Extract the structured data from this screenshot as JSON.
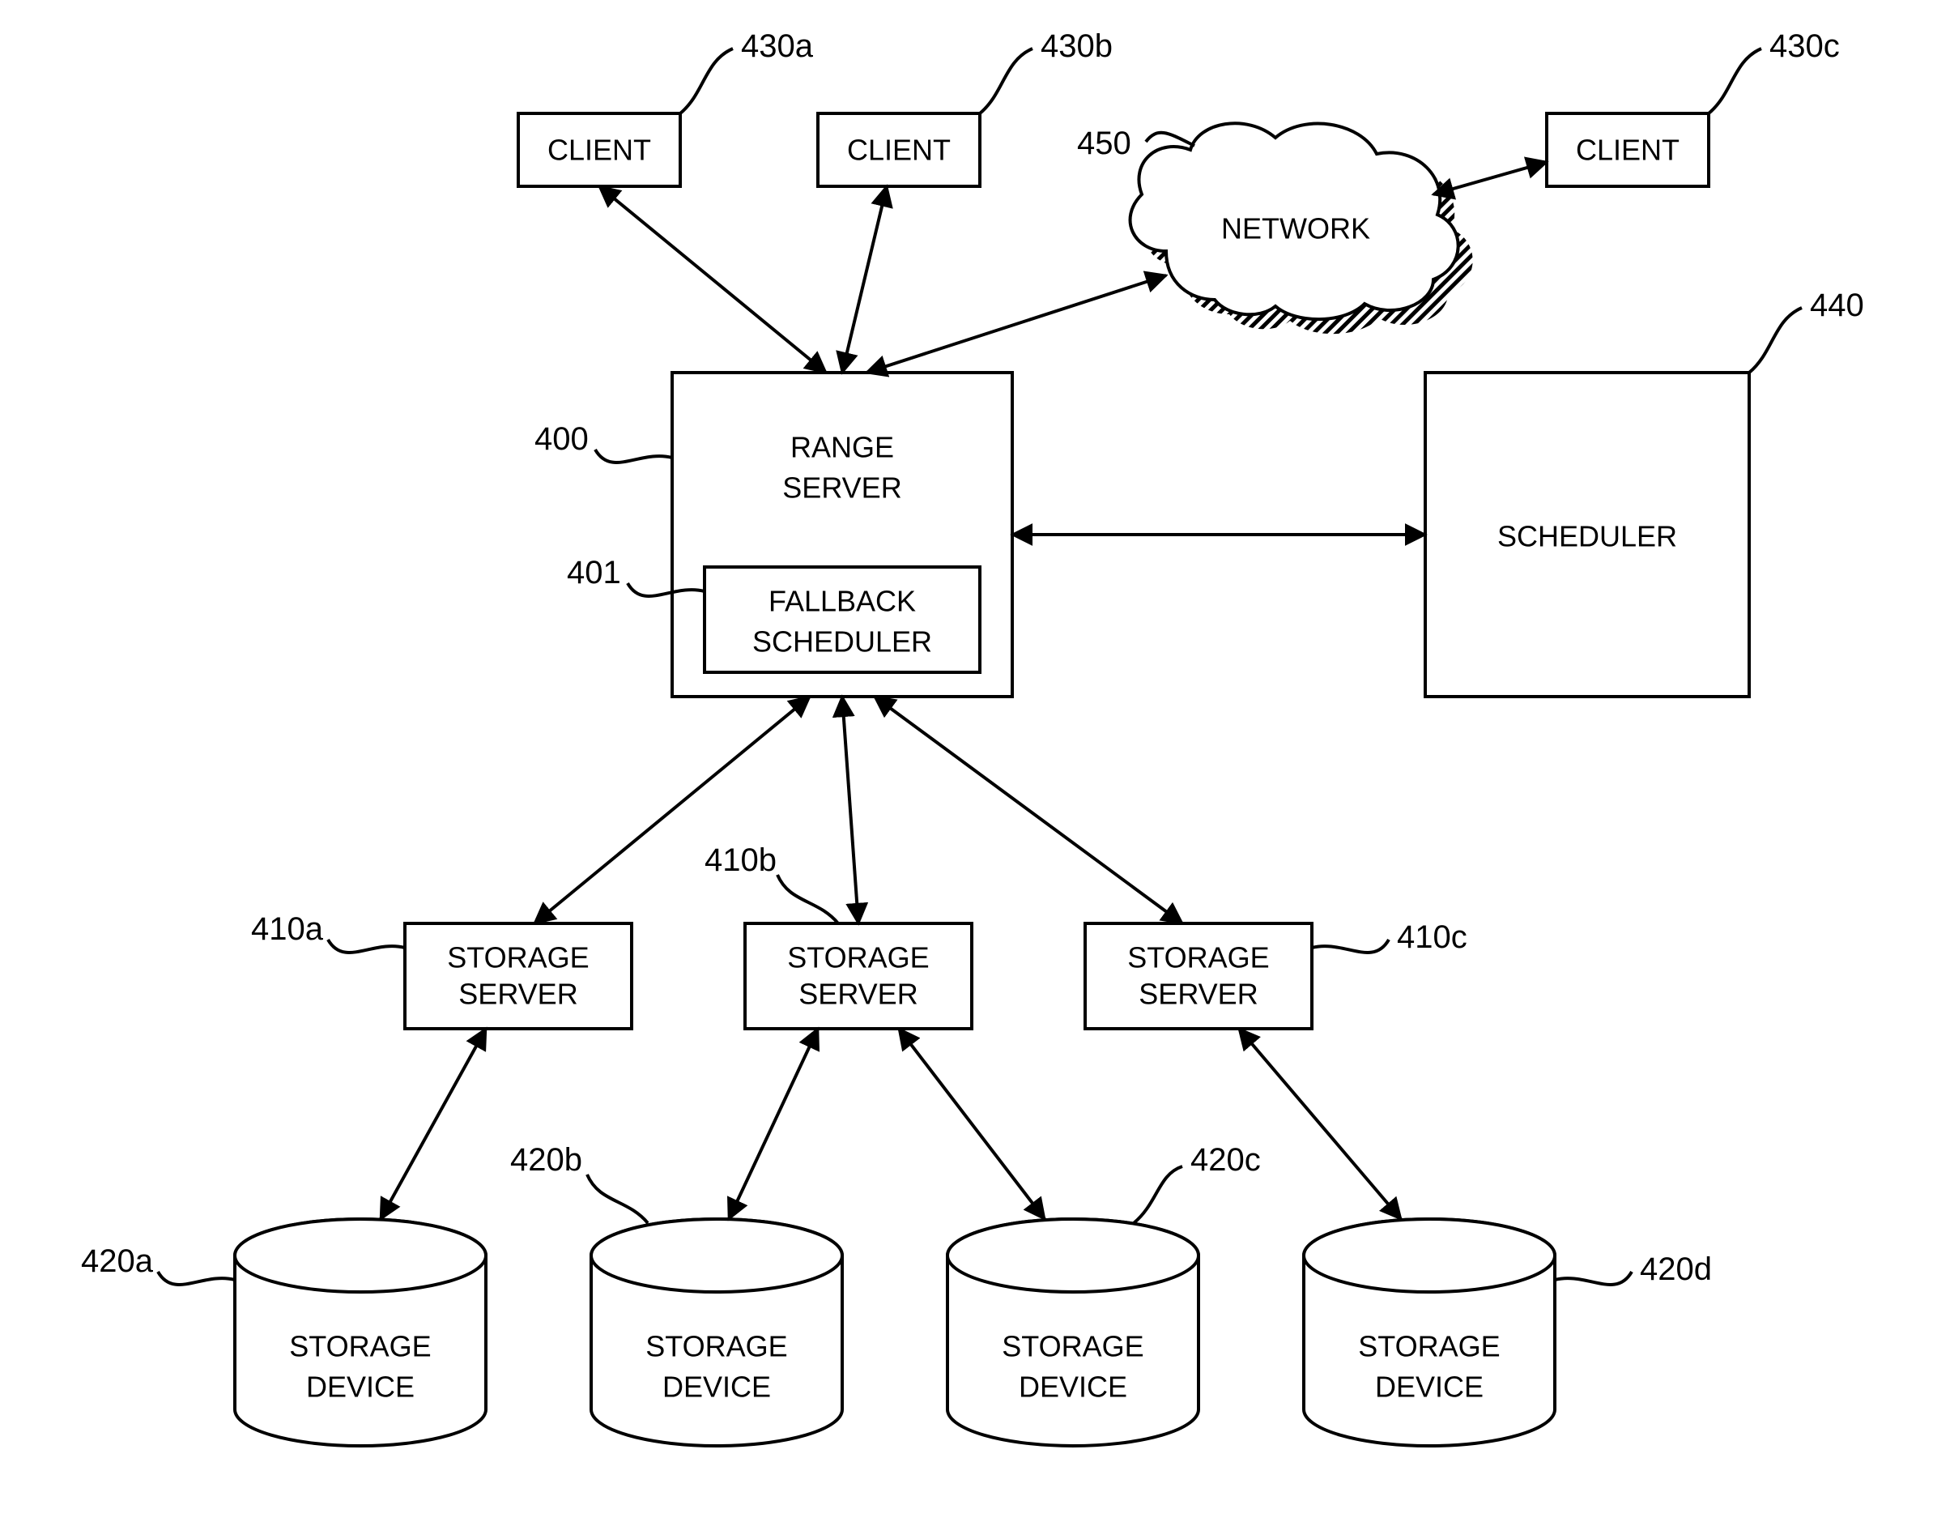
{
  "clients": {
    "a": {
      "label": "CLIENT",
      "ref": "430a"
    },
    "b": {
      "label": "CLIENT",
      "ref": "430b"
    },
    "c": {
      "label": "CLIENT",
      "ref": "430c"
    }
  },
  "network": {
    "label": "NETWORK",
    "ref": "450"
  },
  "range_server": {
    "label_line1": "RANGE",
    "label_line2": "SERVER",
    "ref": "400",
    "fallback": {
      "label_line1": "FALLBACK",
      "label_line2": "SCHEDULER",
      "ref": "401"
    }
  },
  "scheduler": {
    "label": "SCHEDULER",
    "ref": "440"
  },
  "storage_servers": {
    "a": {
      "label_line1": "STORAGE",
      "label_line2": "SERVER",
      "ref": "410a"
    },
    "b": {
      "label_line1": "STORAGE",
      "label_line2": "SERVER",
      "ref": "410b"
    },
    "c": {
      "label_line1": "STORAGE",
      "label_line2": "SERVER",
      "ref": "410c"
    }
  },
  "storage_devices": {
    "a": {
      "label_line1": "STORAGE",
      "label_line2": "DEVICE",
      "ref": "420a"
    },
    "b": {
      "label_line1": "STORAGE",
      "label_line2": "DEVICE",
      "ref": "420b"
    },
    "c": {
      "label_line1": "STORAGE",
      "label_line2": "DEVICE",
      "ref": "420c"
    },
    "d": {
      "label_line1": "STORAGE",
      "label_line2": "DEVICE",
      "ref": "420d"
    }
  }
}
